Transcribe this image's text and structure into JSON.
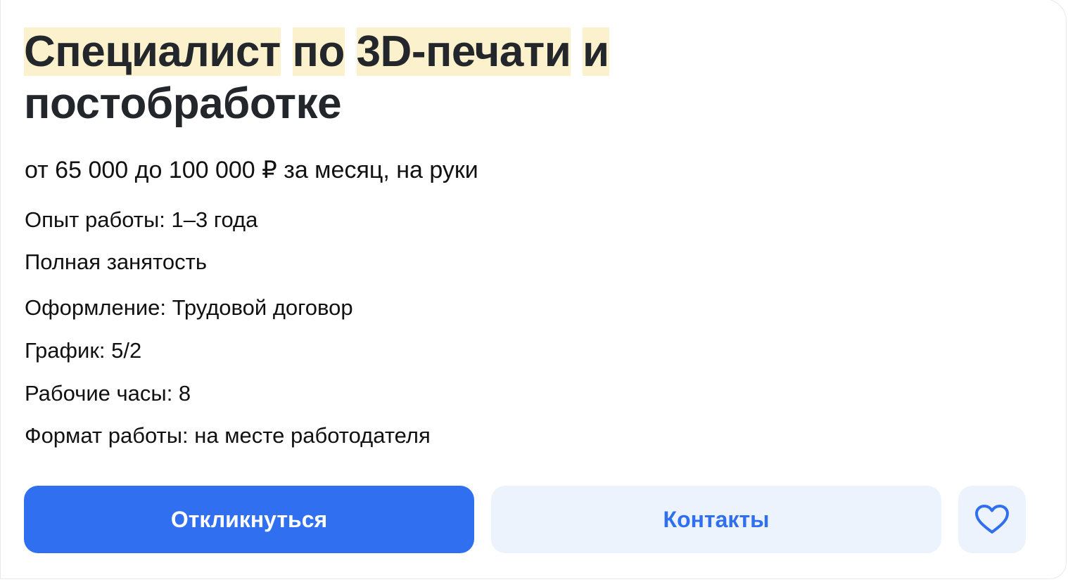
{
  "vacancy": {
    "title_words": [
      "Специалист",
      "по",
      "3D-печати",
      "и"
    ],
    "title_line2": "постобработке",
    "salary": "от 65 000 до 100 000 ₽ за месяц, на руки",
    "details": [
      "Опыт работы: 1–3 года",
      "Полная занятость",
      "Оформление: Трудовой договор",
      "График: 5/2",
      "Рабочие часы: 8",
      "Формат работы: на месте работодателя"
    ],
    "highlight_color": "#fbf1cc"
  },
  "actions": {
    "respond_label": "Откликнуться",
    "contacts_label": "Контакты",
    "favorite_icon": "heart-icon",
    "primary_color": "#2f6ff0",
    "secondary_bg": "#edf3fd"
  }
}
